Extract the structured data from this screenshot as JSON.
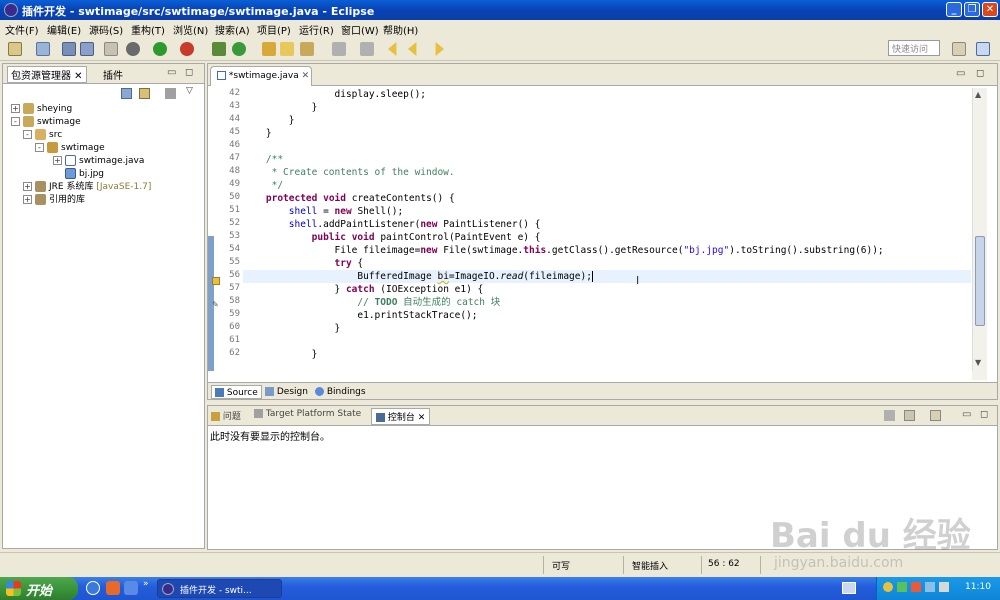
{
  "window": {
    "title": "插件开发 - swtimage/src/swtimage/swtimage.java - Eclipse"
  },
  "menu": [
    "文件(F)",
    "编辑(E)",
    "源码(S)",
    "重构(T)",
    "浏览(N)",
    "搜索(A)",
    "项目(P)",
    "运行(R)",
    "窗口(W)",
    "帮助(H)"
  ],
  "toolbar": {
    "quick_access_placeholder": "快速访问"
  },
  "left_panel": {
    "tabs": [
      "包资源管理器",
      "插件"
    ],
    "tree": [
      {
        "label": "sheying",
        "expander": "+"
      },
      {
        "label": "swtimage",
        "expander": "-"
      },
      {
        "label": "src",
        "expander": "-"
      },
      {
        "label": "swtimage",
        "expander": "-"
      },
      {
        "label": "swtimage.java",
        "expander": "+"
      },
      {
        "label": "bj.jpg",
        "expander": ""
      },
      {
        "label": "JRE 系统库",
        "suffix": "[JavaSE-1.7]",
        "expander": "+"
      },
      {
        "label": "引用的库",
        "expander": "+"
      }
    ]
  },
  "editor": {
    "tab_label": "*swtimage.java",
    "line_numbers": [
      "42",
      "43",
      "44",
      "45",
      "46",
      "47",
      "48",
      "49",
      "50",
      "51",
      "52",
      "53",
      "54",
      "55",
      "56",
      "57",
      "58",
      "59",
      "60",
      "61",
      "62"
    ],
    "bottom_tabs": [
      "Source",
      "Design",
      "Bindings"
    ]
  },
  "console": {
    "tabs": [
      "问题",
      "Target Platform State",
      "控制台"
    ],
    "message": "此时没有要显示的控制台。"
  },
  "status": {
    "mode": "可写",
    "insert": "智能插入",
    "position": "56 : 62"
  },
  "taskbar": {
    "start": "开始",
    "item": "插件开发 - swti...",
    "clock": "11:10"
  },
  "watermark": {
    "text": "Bai du 经验",
    "url": "jingyan.baidu.com"
  }
}
